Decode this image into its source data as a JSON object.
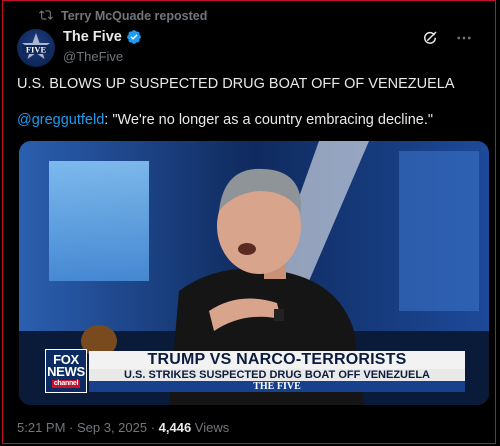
{
  "repost": {
    "text": "Terry McQuade reposted"
  },
  "author": {
    "name": "The Five",
    "handle": "@TheFive",
    "avatar_text": "FIVE"
  },
  "tweet": {
    "line1": "U.S. BLOWS UP SUSPECTED DRUG BOAT OFF OF VENEZUELA",
    "mention": "@greggutfeld",
    "quote": ": \"We're no longer as a country embracing decline.\""
  },
  "media": {
    "logo_top": "FOX",
    "logo_mid": "NEWS",
    "logo_bottom": "channel",
    "headline": "TRUMP VS NARCO-TERRORISTS",
    "subheadline": "U.S. STRIKES SUSPECTED DRUG BOAT OFF VENEZUELA",
    "show": "THE FIVE"
  },
  "meta": {
    "timestamp": "5:21 PM · Sep 3, 2025 · ",
    "views_count": "4,446",
    "views_label": " Views"
  },
  "icons": [
    "repost-icon",
    "verified-badge-icon",
    "grok-icon",
    "more-icon"
  ],
  "colors": {
    "accent": "#1d9bf0",
    "muted": "#71767b",
    "text": "#e7e9ea",
    "frame": "#c0102a"
  }
}
